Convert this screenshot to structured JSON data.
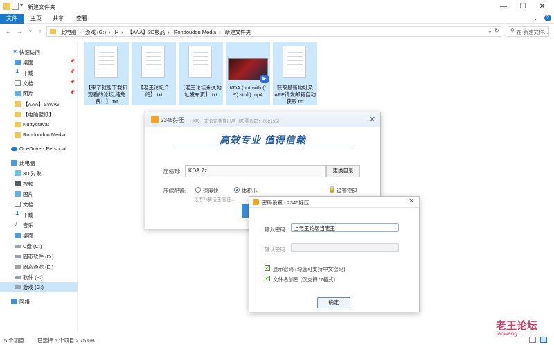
{
  "window": {
    "title": "新建文件夹",
    "controls": [
      "—",
      "☐",
      "✕"
    ]
  },
  "ribbon": {
    "tabs": [
      "文件",
      "主页",
      "共享",
      "查看"
    ],
    "help": "?"
  },
  "address": {
    "crumbs": [
      "此电脑",
      "游戏 (G:)",
      "H",
      "【AAA】3D极品",
      "Rondoudou Media",
      "新建文件夹"
    ],
    "search_placeholder": "在 新建文件..."
  },
  "sidebar": {
    "items": [
      {
        "label": "快速访问",
        "icon": "star-icon"
      },
      {
        "label": "桌面",
        "icon": "desktop-icon",
        "pinned": true
      },
      {
        "label": "下载",
        "icon": "download-icon",
        "pinned": true
      },
      {
        "label": "文档",
        "icon": "document-icon",
        "pinned": true
      },
      {
        "label": "图片",
        "icon": "picture-icon",
        "pinned": true
      },
      {
        "label": "【AAA】SWAG",
        "icon": "folder-icon"
      },
      {
        "label": "【电脑壁纸】",
        "icon": "folder-icon"
      },
      {
        "label": "Nuttycravat",
        "icon": "folder-icon"
      },
      {
        "label": "Rondoudou Media",
        "icon": "folder-icon"
      },
      {
        "label": "OneDrive - Personal",
        "icon": "cloud-icon"
      },
      {
        "label": "此电脑",
        "icon": "computer-icon"
      },
      {
        "label": "3D 对象",
        "icon": "cube-icon"
      },
      {
        "label": "视频",
        "icon": "video-icon"
      },
      {
        "label": "图片",
        "icon": "picture-icon"
      },
      {
        "label": "文档",
        "icon": "document-icon"
      },
      {
        "label": "下载",
        "icon": "download-icon"
      },
      {
        "label": "音乐",
        "icon": "music-icon"
      },
      {
        "label": "桌面",
        "icon": "desktop-icon"
      },
      {
        "label": "C盘 (C:)",
        "icon": "drive-icon"
      },
      {
        "label": "固态软件 (D:)",
        "icon": "drive-icon"
      },
      {
        "label": "固态游戏 (E:)",
        "icon": "drive-icon"
      },
      {
        "label": "软件 (F:)",
        "icon": "drive-icon"
      },
      {
        "label": "游戏 (G:)",
        "icon": "drive-icon"
      },
      {
        "label": "网络",
        "icon": "network-icon"
      }
    ]
  },
  "files": [
    {
      "name": "【来了就能下载和观看的论坛,纯免费！】.txt",
      "type": "txt"
    },
    {
      "name": "【老王论坛介绍】.txt",
      "type": "txt"
    },
    {
      "name": "【老王论坛永久地址发布页】.txt",
      "type": "txt"
    },
    {
      "name": "KDA (but with (˘ ³˘) stuff).mp4",
      "type": "mp4"
    },
    {
      "name": "获取最新地址及APP请发邮箱自动获取.txt",
      "type": "txt"
    }
  ],
  "compress_dialog": {
    "app_name": "2345好压",
    "subtitle": "- A股上市公司荣誉出品（股票代码：002195）",
    "banner": "高效专业 值得信赖",
    "path_label": "压缩到:",
    "path_value": "KDA.7z",
    "change_dir": "更换目录",
    "config_label": "压缩配置:",
    "option_fast": "速度快",
    "option_small": "体积小",
    "set_password": "设置密码",
    "hint": "采用7z算法压缩,压..."
  },
  "password_dialog": {
    "title": "密码设置 - 2345好压",
    "enter_label": "输入密码",
    "enter_value": "上老王论坛当老王",
    "confirm_label": "确认密码",
    "confirm_value": "",
    "show_password": "显示密码 (勾选可支持中文密码)",
    "encrypt_names": "文件名加密 (仅支持7z格式)",
    "ok": "确定"
  },
  "status_bar": {
    "count": "5 个项目",
    "selected": "已选择 5 个项目  2.75 GB"
  },
  "watermark": {
    "title": "老王论坛",
    "domain": "laowang..."
  }
}
